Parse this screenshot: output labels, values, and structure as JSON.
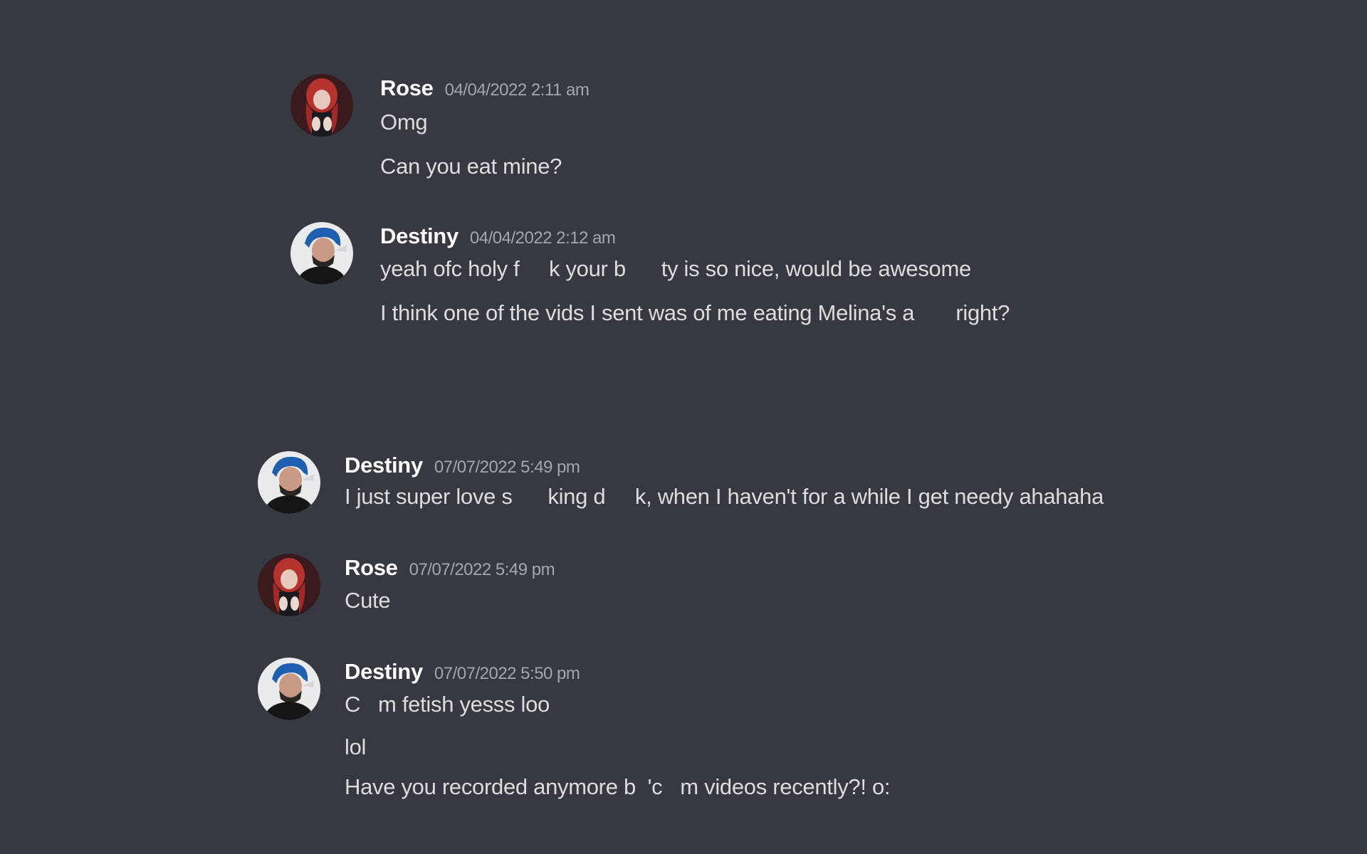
{
  "messages": [
    {
      "username": "Rose",
      "timestamp": "04/04/2022 2:11 am",
      "avatar_icon": "rose-avatar",
      "lines": [
        "Omg",
        "Can you eat mine?"
      ]
    },
    {
      "username": "Destiny",
      "timestamp": "04/04/2022 2:12 am",
      "avatar_icon": "destiny-avatar",
      "lines": [
        "yeah ofc holy f     k your b      ty is so nice, would be awesome",
        "I think one of the vids I sent was of me eating Melina's a       right?"
      ]
    },
    {
      "username": "Destiny",
      "timestamp": "07/07/2022 5:49 pm",
      "avatar_icon": "destiny-avatar",
      "lines": [
        "I just super love s      king d     k, when I haven't for a while I get needy ahahaha"
      ]
    },
    {
      "username": "Rose",
      "timestamp": "07/07/2022 5:49 pm",
      "avatar_icon": "rose-avatar",
      "lines": [
        "Cute"
      ]
    },
    {
      "username": "Destiny",
      "timestamp": "07/07/2022 5:50 pm",
      "avatar_icon": "destiny-avatar",
      "lines": [
        "C   m fetish yesss loo",
        "lol",
        "Have you recorded anymore b  'c   m videos recently?! o:"
      ]
    }
  ],
  "colors": {
    "background": "#36393f",
    "username": "#ffffff",
    "timestamp": "#a3a6aa",
    "message_text": "#dcddde"
  }
}
